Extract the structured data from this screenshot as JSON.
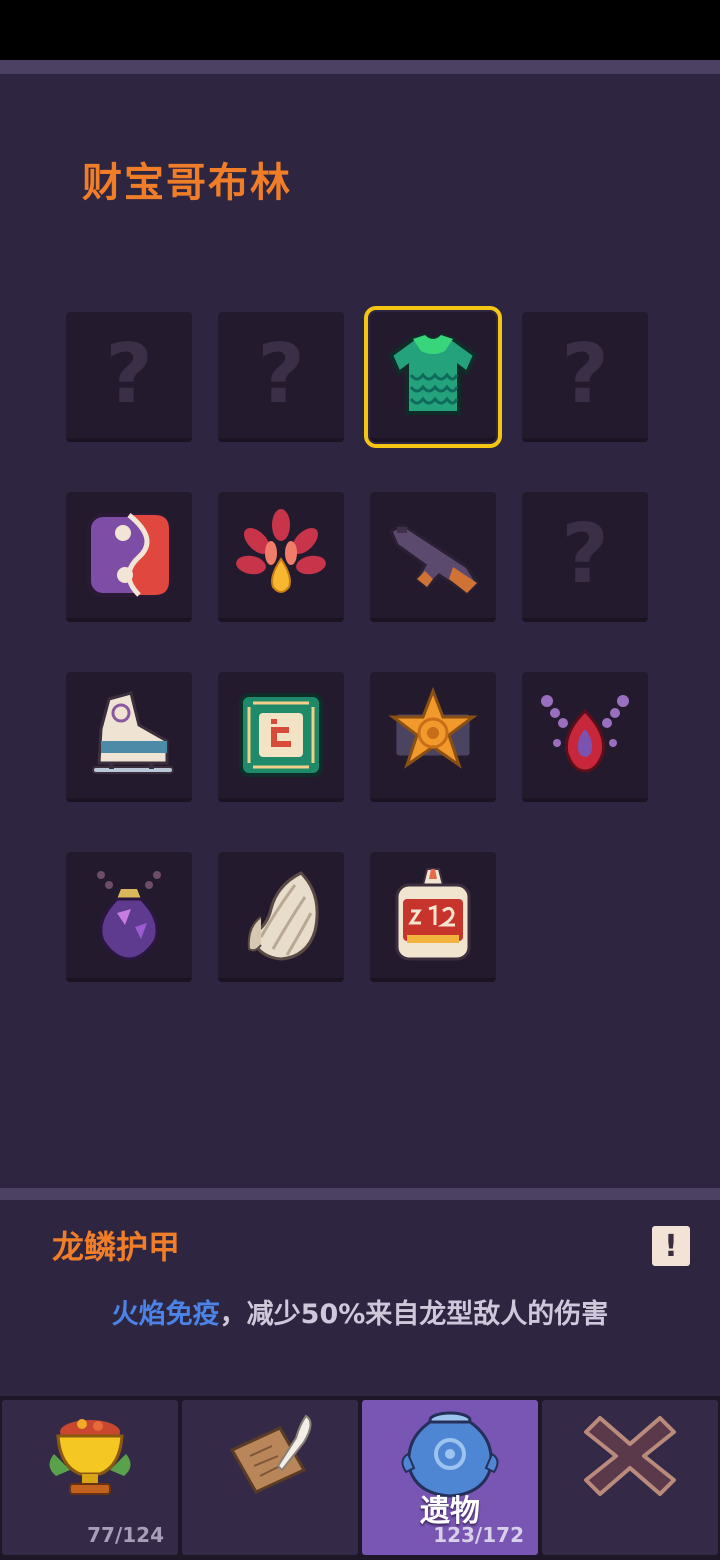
{
  "page": {
    "title": "财宝哥布林"
  },
  "relics": [
    {
      "name": "unknown-slot",
      "unknown": true,
      "glyph": "?"
    },
    {
      "name": "unknown-slot",
      "unknown": true,
      "glyph": "?"
    },
    {
      "name": "dragon-scale-armor",
      "unknown": false,
      "icon": "dragon-scale-armor-icon",
      "selected": true
    },
    {
      "name": "unknown-slot",
      "unknown": true,
      "glyph": "?"
    },
    {
      "name": "yin-yang-dice",
      "unknown": false,
      "icon": "yin-yang-dice-icon"
    },
    {
      "name": "flame-feather-fan",
      "unknown": false,
      "icon": "flame-fan-icon"
    },
    {
      "name": "assault-rifle",
      "unknown": false,
      "icon": "rifle-icon"
    },
    {
      "name": "unknown-slot",
      "unknown": true,
      "glyph": "?"
    },
    {
      "name": "ice-skate",
      "unknown": false,
      "icon": "skate-icon"
    },
    {
      "name": "microchip",
      "unknown": false,
      "icon": "chip-icon"
    },
    {
      "name": "sheriff-badge",
      "unknown": false,
      "icon": "sheriff-badge-icon"
    },
    {
      "name": "blood-drop-necklace",
      "unknown": false,
      "icon": "necklace-icon"
    },
    {
      "name": "amethyst-amulet",
      "unknown": false,
      "icon": "amulet-icon"
    },
    {
      "name": "angel-wing",
      "unknown": false,
      "icon": "wing-icon"
    },
    {
      "name": "glue-bottle",
      "unknown": false,
      "icon": "glue-bottle-icon"
    }
  ],
  "detail": {
    "name": "龙鳞护甲",
    "alert_glyph": "!",
    "highlight": "火焰免疫",
    "description": "，减少50%来自龙型敌人的伤害"
  },
  "tabs": [
    {
      "icon": "golden-trophy-icon",
      "count": "77/124",
      "label": ""
    },
    {
      "icon": "scroll-quill-icon",
      "count": "",
      "label": ""
    },
    {
      "icon": "relic-jar-icon",
      "count": "123/172",
      "label": "遗物",
      "active": true
    },
    {
      "icon": "close-icon",
      "count": "",
      "label": ""
    }
  ],
  "colors": {
    "accent": "#f07d28",
    "selected_border": "#f5c514",
    "highlight_text": "#4b83e6",
    "active_tab": "#7a56b4"
  }
}
